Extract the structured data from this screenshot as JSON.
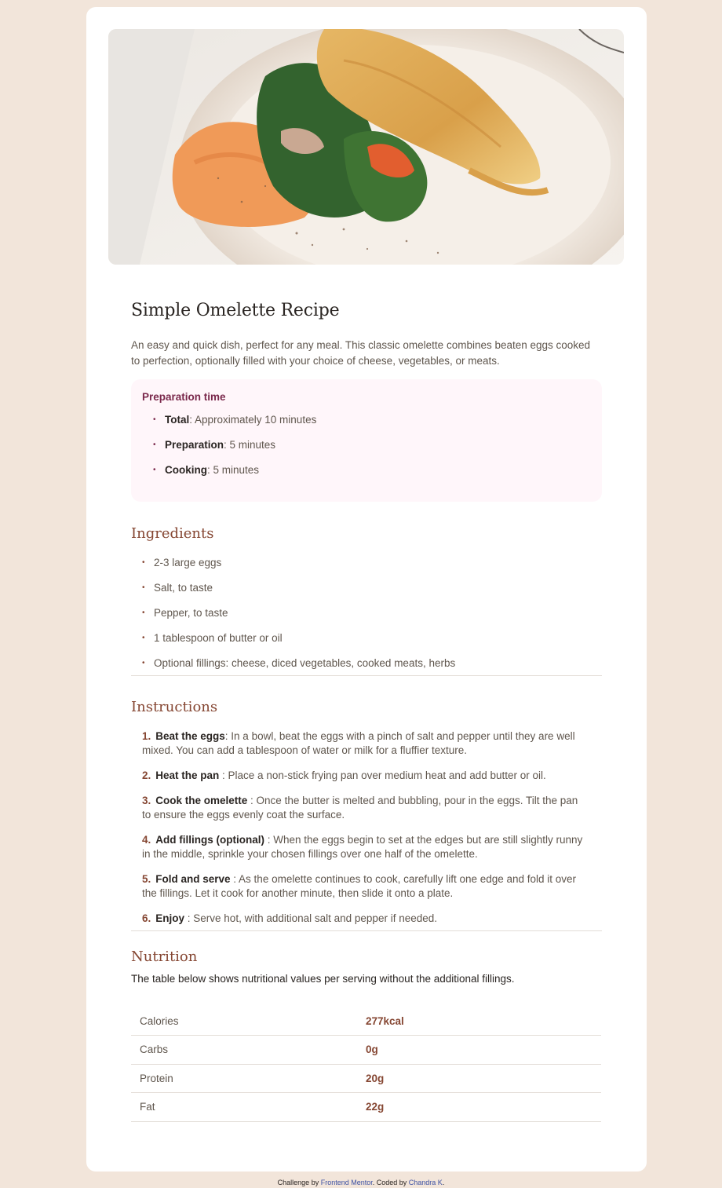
{
  "hero": {
    "image_alt": "Omelette with spinach and hummus on a plate"
  },
  "recipe": {
    "title": "Simple Omelette Recipe",
    "intro": "An easy and quick dish, perfect for any meal. This classic omelette combines beaten eggs cooked to perfection, optionally filled with your choice of cheese, vegetables, or meats."
  },
  "preparation": {
    "heading": "Preparation time",
    "items": [
      {
        "label": "Total",
        "text": ": Approximately 10 minutes"
      },
      {
        "label": "Preparation",
        "text": ": 5 minutes"
      },
      {
        "label": "Cooking",
        "text": ": 5 minutes"
      }
    ]
  },
  "ingredients": {
    "heading": "Ingredients",
    "items": [
      "2-3 large eggs",
      "Salt, to taste",
      "Pepper, to taste",
      "1 tablespoon of butter or oil",
      "Optional fillings: cheese, diced vegetables, cooked meats, herbs"
    ]
  },
  "instructions": {
    "heading": "Instructions",
    "steps": [
      {
        "num": "1.",
        "label": "Beat the eggs",
        "text": ": In a bowl, beat the eggs with a pinch of salt and pepper until they are well mixed. You can add a tablespoon of water or milk for a fluffier texture."
      },
      {
        "num": "2.",
        "label": "Heat the pan",
        "text": " : Place a non-stick frying pan over medium heat and add butter or oil."
      },
      {
        "num": "3.",
        "label": "Cook the omelette",
        "text": " : Once the butter is melted and bubbling, pour in the eggs. Tilt the pan to ensure the eggs evenly coat the surface."
      },
      {
        "num": "4.",
        "label": "Add fillings (optional)",
        "text": " : When the eggs begin to set at the edges but are still slightly runny in the middle, sprinkle your chosen fillings over one half of the omelette."
      },
      {
        "num": "5.",
        "label": "Fold and serve",
        "text": " : As the omelette continues to cook, carefully lift one edge and fold it over the fillings. Let it cook for another minute, then slide it onto a plate."
      },
      {
        "num": "6.",
        "label": "Enjoy",
        "text": " : Serve hot, with additional salt and pepper if needed."
      }
    ]
  },
  "nutrition": {
    "heading": "Nutrition",
    "intro": "The table below shows nutritional values per serving without the additional fillings.",
    "rows": [
      {
        "label": "Calories",
        "value": "277kcal"
      },
      {
        "label": "Carbs",
        "value": "0g"
      },
      {
        "label": "Protein",
        "value": "20g"
      },
      {
        "label": "Fat",
        "value": "22g"
      }
    ]
  },
  "footer": {
    "prefix": "Challenge by ",
    "link1": "Frontend Mentor",
    "middle": ". Coded by ",
    "link2": "Chandra K",
    "suffix": "."
  },
  "colors": {
    "page_bg": "#f2e5da",
    "accent_brown": "#854632",
    "prep_bg": "#fff6fa",
    "prep_heading": "#7a284b"
  }
}
